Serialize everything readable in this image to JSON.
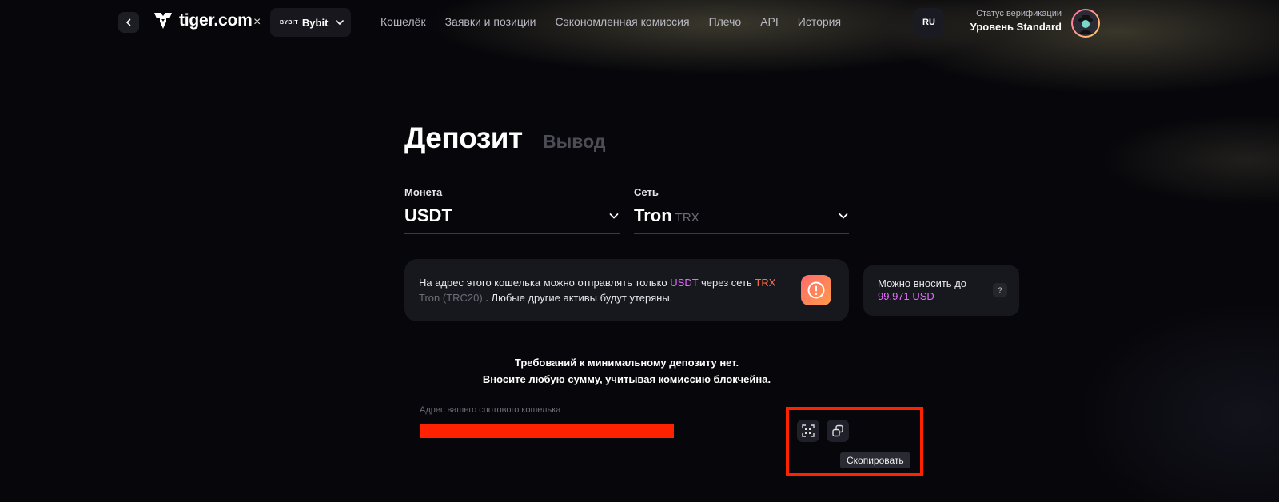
{
  "header": {
    "logo_text": "tiger.com",
    "cross": "×",
    "exchange": {
      "small_pre": "BYB",
      "small_mid": "!",
      "small_post": "T",
      "name": "Bybit"
    },
    "nav": [
      "Кошелёк",
      "Заявки и позиции",
      "Сэкономленная комиссия",
      "Плечо",
      "API",
      "История"
    ],
    "lang": "RU",
    "verification_status": "Статус верификации",
    "verification_level": "Уровень Standard"
  },
  "tabs": {
    "deposit": "Депозит",
    "withdraw": "Вывод"
  },
  "coin": {
    "label": "Монета",
    "value": "USDT"
  },
  "network": {
    "label": "Сеть",
    "value": "Tron",
    "sub": "TRX"
  },
  "warning": {
    "part1": "На адрес этого кошелька можно отправлять только ",
    "coin": "USDT",
    "part2": " через сеть ",
    "net": "TRX",
    "net_full": "Tron (TRC20)",
    "part3": " . Любые другие активы будут утеряны."
  },
  "limit": {
    "label": "Можно вносить до",
    "value": "99,971 USD",
    "help": "?"
  },
  "min_deposit": {
    "line1": "Требований к минимальному депозиту нет.",
    "line2": "Вносите любую сумму, учитывая комиссию блокчейна."
  },
  "address": {
    "label": "Адрес вашего спотового кошелька"
  },
  "tooltip": "Скопировать",
  "colors": {
    "accent_pink": "#e46bff",
    "accent_orange": "#ff6d4d",
    "highlight": "#ff2200",
    "background": "#07070b"
  }
}
